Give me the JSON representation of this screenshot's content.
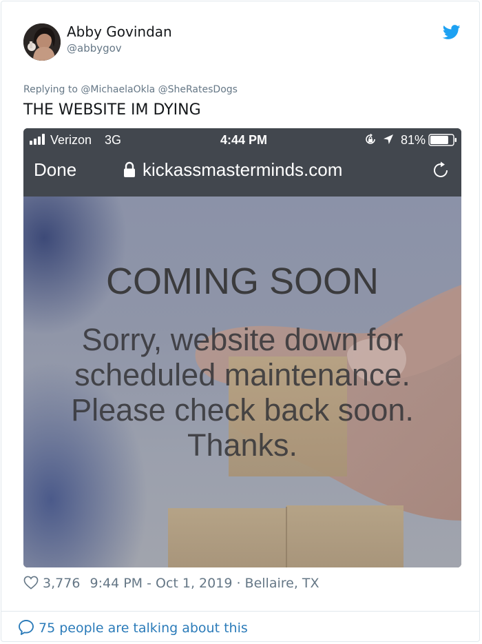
{
  "tweet": {
    "author": {
      "display_name": "Abby Govindan",
      "handle": "@abbygov"
    },
    "reply_to": {
      "prefix": "Replying to",
      "mentions": [
        "@MichaelaOkla",
        "@SheRatesDogs"
      ]
    },
    "text": "THE WEBSITE IM DYING",
    "likes": "3,776",
    "timestamp": "9:44 PM - Oct 1, 2019",
    "location_separator": "·",
    "location": "Bellaire, TX",
    "conversation_text": "75 people are talking about this",
    "colors": {
      "text": "#14171a",
      "secondary": "#657786",
      "link": "#2b7bb9",
      "brand": "#1da1f2",
      "border": "#e1e8ed"
    },
    "icons": [
      "twitter-bird-icon",
      "heart-icon",
      "speech-bubble-icon"
    ]
  },
  "screenshot": {
    "status_bar": {
      "carrier": "Verizon",
      "network": "3G",
      "time": "4:44 PM",
      "battery": "81%",
      "battery_level": 0.81
    },
    "browser": {
      "done_label": "Done",
      "url": "kickassmasterminds.com"
    },
    "site": {
      "heading": "COMING SOON",
      "message_lines": [
        "Sorry, website down for",
        "scheduled maintenance.",
        "Please check back soon.",
        "Thanks."
      ]
    },
    "icons": [
      "signal-bars-icon",
      "rotation-lock-icon",
      "location-arrow-icon",
      "battery-icon",
      "padlock-icon",
      "reload-icon"
    ]
  }
}
